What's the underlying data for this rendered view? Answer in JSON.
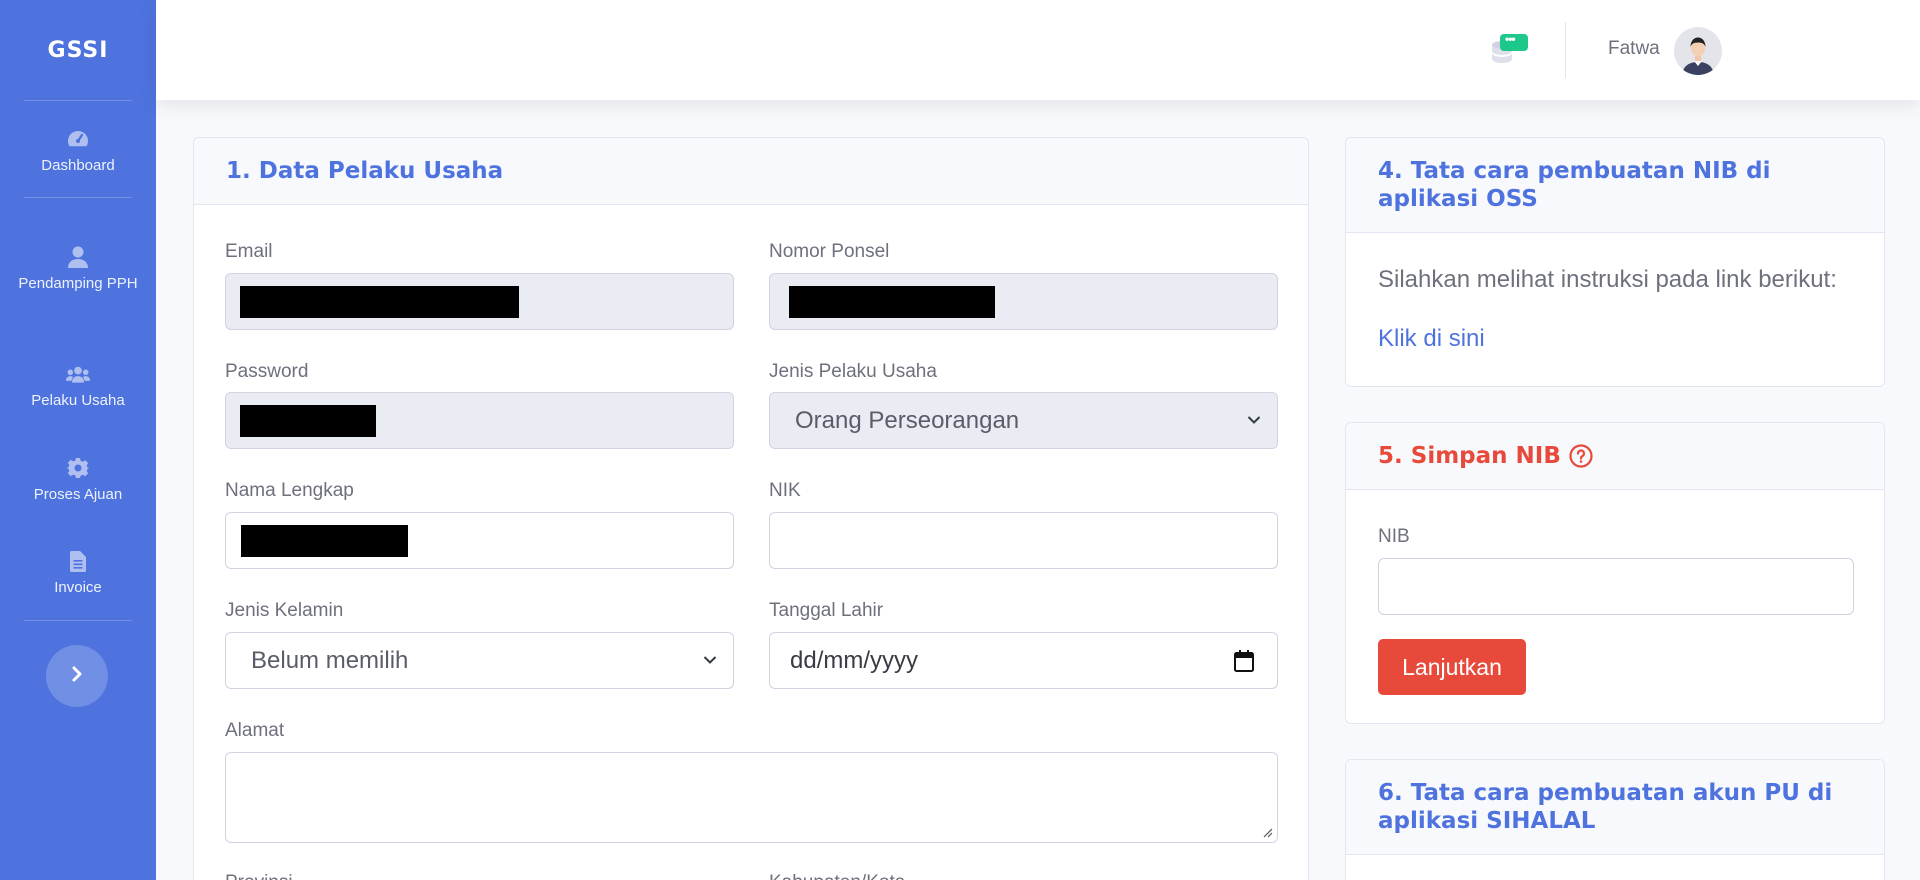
{
  "brand": "GSSI",
  "sidebar": {
    "items": [
      {
        "label": "Dashboard",
        "icon": "tachometer-icon"
      },
      {
        "label": "Pendamping PPH",
        "icon": "user-icon"
      },
      {
        "label": "Pelaku Usaha",
        "icon": "users-icon"
      },
      {
        "label": "Proses Ajuan",
        "icon": "gear-icon"
      },
      {
        "label": "Invoice",
        "icon": "file-icon"
      }
    ],
    "toggle_icon": "chevron-right-icon"
  },
  "topbar": {
    "notification_badge": "•••",
    "username": "Fatwa"
  },
  "form_card": {
    "title": "1. Data Pelaku Usaha",
    "fields": {
      "email_label": "Email",
      "phone_label": "Nomor Ponsel",
      "password_label": "Password",
      "business_type_label": "Jenis Pelaku Usaha",
      "business_type_value": "Orang Perseorangan",
      "fullname_label": "Nama Lengkap",
      "nik_label": "NIK",
      "gender_label": "Jenis Kelamin",
      "gender_value": "Belum memilih",
      "birthdate_label": "Tanggal Lahir",
      "birthdate_placeholder": "dd/mm/yyyy",
      "address_label": "Alamat",
      "province_label": "Provinsi",
      "city_label": "Kabupaten/Kota"
    }
  },
  "nib_guide_card": {
    "title": "4. Tata cara pembuatan NIB di aplikasi OSS",
    "instruction": "Silahkan melihat instruksi pada link berikut:",
    "link": "Klik di sini"
  },
  "save_nib_card": {
    "title": "5. Simpan NIB",
    "nib_label": "NIB",
    "button": "Lanjutkan"
  },
  "pu_guide_card": {
    "title": "6. Tata cara pembuatan akun PU di aplikasi SIHALAL"
  },
  "colors": {
    "primary": "#4e73df",
    "danger": "#e74a3b",
    "success": "#1cc88a"
  }
}
